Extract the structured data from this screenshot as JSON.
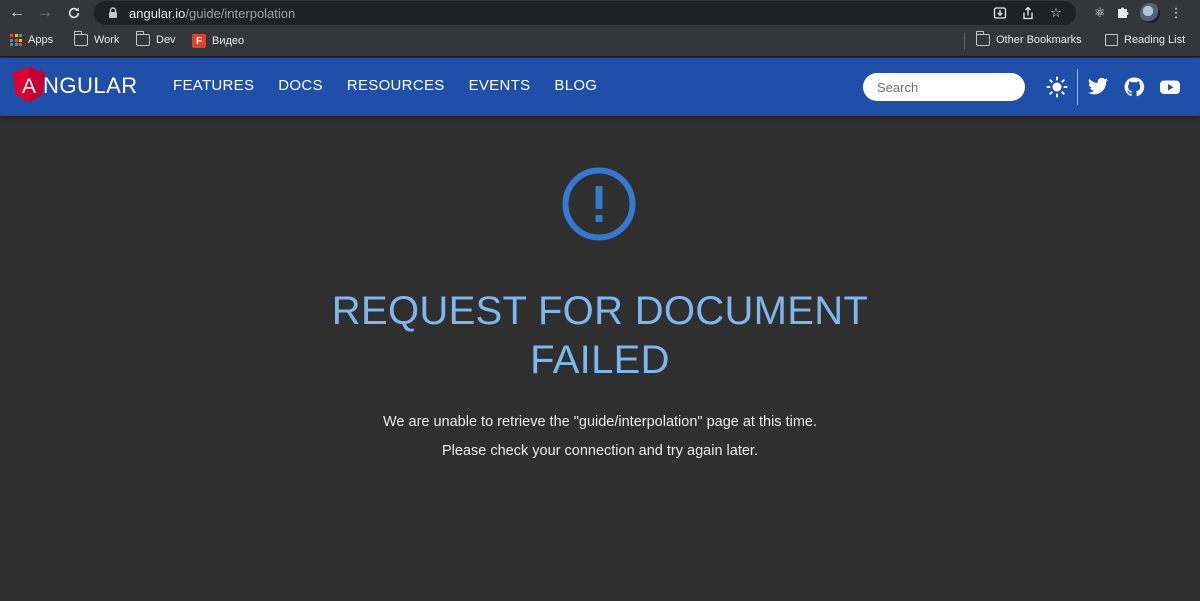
{
  "browser": {
    "url_host": "angular.io",
    "url_path": "/guide/interpolation",
    "bookmarks": [
      {
        "label": "Apps"
      },
      {
        "label": "Work"
      },
      {
        "label": "Dev"
      },
      {
        "label": "Видео"
      }
    ],
    "bookmarks_right": [
      {
        "label": "Other Bookmarks"
      },
      {
        "label": "Reading List"
      }
    ]
  },
  "site": {
    "logo_letter": "A",
    "logo_text": "NGULAR",
    "nav": [
      {
        "label": "FEATURES"
      },
      {
        "label": "DOCS"
      },
      {
        "label": "RESOURCES"
      },
      {
        "label": "EVENTS"
      },
      {
        "label": "BLOG"
      }
    ],
    "search": {
      "placeholder": "Search"
    }
  },
  "error": {
    "title": "REQUEST FOR DOCUMENT FAILED",
    "line1": "We are unable to retrieve the \"guide/interpolation\" page at this time.",
    "line2": "Please check your connection and try again later."
  },
  "colors": {
    "topbar": "#1f4fa8",
    "error_title": "#7fb6ee",
    "error_icon": "#3579d0",
    "page_background": "#2f2f2f"
  }
}
